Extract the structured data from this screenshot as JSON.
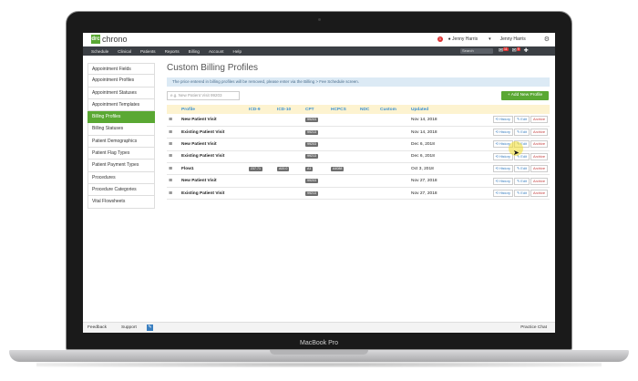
{
  "laptop": {
    "brand": "MacBook Pro"
  },
  "app": {
    "logo_mark": "drc",
    "logo_text": "chrono",
    "notification_count": "3",
    "user_name": "Jenny Harris",
    "user_name_2": "Jenny Harris",
    "dropdown_caret": "▾"
  },
  "nav": {
    "items": [
      "Schedule",
      "Clinical",
      "Patients",
      "Reports",
      "Billing",
      "Account",
      "Help"
    ],
    "search_placeholder": "Search",
    "icons": [
      {
        "name": "mail-icon",
        "glyph": "✉",
        "badge": "11"
      },
      {
        "name": "message-icon",
        "glyph": "✉",
        "badge": "9"
      },
      {
        "name": "plus-icon",
        "glyph": "✚",
        "badge": ""
      }
    ]
  },
  "sidebar": {
    "items": [
      {
        "label": "Appointment Fields",
        "active": false
      },
      {
        "label": "Appointment Profiles",
        "active": false
      },
      {
        "label": "Appointment Statuses",
        "active": false
      },
      {
        "label": "Appointment Templates",
        "active": false
      },
      {
        "label": "Billing Profiles",
        "active": true
      },
      {
        "label": "Billing Statuses",
        "active": false
      },
      {
        "label": "Patient Demographics",
        "active": false
      },
      {
        "label": "Patient Flag Types",
        "active": false
      },
      {
        "label": "Patient Payment Types",
        "active": false
      },
      {
        "label": "Procedures",
        "active": false
      },
      {
        "label": "Procedure Categories",
        "active": false
      },
      {
        "label": "Vital Flowsheets",
        "active": false
      }
    ]
  },
  "main": {
    "title": "Custom Billing Profiles",
    "info": "The price entered in billing profiles will be removed, please enter via the Billing > Fee Schedule screen.",
    "filter_placeholder": "e.g. New Patient Visit  99203",
    "add_button": "+ Add New Profile",
    "columns": [
      "",
      "Profile",
      "ICD-9",
      "ICD-10",
      "CPT",
      "HCPCS",
      "NDC",
      "Custom",
      "Updated",
      ""
    ],
    "action_labels": {
      "history": "History",
      "edit": "Edit",
      "archive": "Archive"
    },
    "rows": [
      {
        "profile": "New Patient Visit",
        "icd9": "",
        "icd10": "",
        "cpt": "99203",
        "hcpcs": "",
        "updated": "Nov 14, 2018"
      },
      {
        "profile": "Existing Patient Visit",
        "icd9": "",
        "icd10": "",
        "cpt": "99213",
        "hcpcs": "",
        "updated": "Nov 14, 2018"
      },
      {
        "profile": "New Patient Visit",
        "icd9": "",
        "icd10": "",
        "cpt": "99203",
        "hcpcs": "",
        "updated": "Dec 6, 2018"
      },
      {
        "profile": "Existing Patient Visit",
        "icd9": "",
        "icd10": "",
        "cpt": "99213",
        "hcpcs": "",
        "updated": "Dec 6, 2018"
      },
      {
        "profile": "Flow1",
        "icd9": "237.71",
        "icd10": "A00.0",
        "cpt": "A1",
        "hcpcs": "A4088",
        "updated": "Oct 3, 2018"
      },
      {
        "profile": "New Patient Visit",
        "icd9": "",
        "icd10": "",
        "cpt": "99203",
        "hcpcs": "",
        "updated": "Nov 27, 2018"
      },
      {
        "profile": "Existing Patient Visit",
        "icd9": "",
        "icd10": "",
        "cpt": "99213",
        "hcpcs": "",
        "updated": "Nov 27, 2018"
      }
    ]
  },
  "footer": {
    "feedback": "Feedback",
    "support": "Support",
    "chat": "Practice Chat"
  },
  "colors": {
    "accent": "#5aa833",
    "nav": "#3b3f44",
    "link": "#3a8fd0",
    "header_row": "#fdf3d0"
  }
}
